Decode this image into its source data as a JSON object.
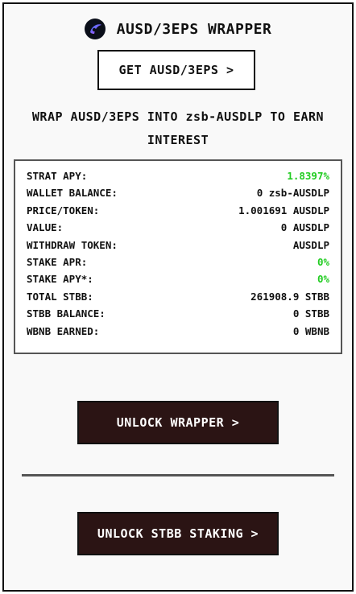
{
  "header": {
    "title": "AUSD/3EPS WRAPPER",
    "logo_icon": "crescent-logo-icon"
  },
  "get_button": {
    "label": "GET AUSD/3EPS >"
  },
  "description": "WRAP AUSD/3EPS INTO zsb-AUSDLP TO EARN INTEREST",
  "stats": [
    {
      "label": "STRAT APY:",
      "value": "1.8397%",
      "highlight": true
    },
    {
      "label": "WALLET BALANCE:",
      "value": "0 zsb-AUSDLP",
      "highlight": false
    },
    {
      "label": "PRICE/TOKEN:",
      "value": "1.001691 AUSDLP",
      "highlight": false
    },
    {
      "label": "VALUE:",
      "value": "0 AUSDLP",
      "highlight": false
    },
    {
      "label": "WITHDRAW TOKEN:",
      "value": "AUSDLP",
      "highlight": false
    },
    {
      "label": "STAKE APR:",
      "value": "0%",
      "highlight": true
    },
    {
      "label": "STAKE APY*:",
      "value": "0%",
      "highlight": true
    },
    {
      "label": "TOTAL STBB:",
      "value": "261908.9 STBB",
      "highlight": false
    },
    {
      "label": "STBB BALANCE:",
      "value": "0 STBB",
      "highlight": false
    },
    {
      "label": "WBNB EARNED:",
      "value": "0 WBNB",
      "highlight": false
    }
  ],
  "unlock_wrapper_button": {
    "label": "UNLOCK WRAPPER >"
  },
  "unlock_staking_button": {
    "label": "UNLOCK STBB STAKING >"
  },
  "colors": {
    "green": "#22cc22",
    "dark_button": "#2b1414"
  }
}
